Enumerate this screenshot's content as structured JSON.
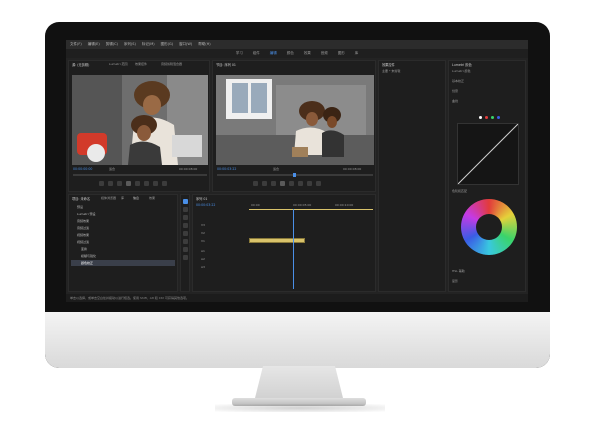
{
  "menu": [
    "文件(F)",
    "编辑(E)",
    "剪辑(C)",
    "序列(S)",
    "标记(M)",
    "图形(G)",
    "窗口(W)",
    "帮助(H)"
  ],
  "workspaces": [
    "学习",
    "组件",
    "编辑",
    "颜色",
    "效果",
    "音频",
    "图形",
    "库"
  ],
  "source_panel": {
    "title": "源: (无剪辑)",
    "tabs": [
      "Lumetri 范围",
      "效果控件",
      "音频剪辑混合器"
    ],
    "timecode": "00:00:00:00",
    "scale": "适合",
    "duration": "00:00:08:00"
  },
  "program_panel": {
    "title": "节目: 序列 01",
    "timecode": "00:00:03:22",
    "scale": "适合",
    "duration": "00:00:08:00"
  },
  "project_panel": {
    "title": "项目: 未命名",
    "tabs": [
      "媒体浏览器",
      "库",
      "信息",
      "效果"
    ],
    "items": [
      "预设",
      "Lumetri 预设",
      "音频效果",
      "音频过渡",
      "视频效果",
      "视频过渡",
      "变换",
      "模糊与锐化",
      "颜色校正"
    ]
  },
  "timeline_panel": {
    "title": "序列 01",
    "timecode": "00:00:03:22",
    "tracks": [
      "V3",
      "V2",
      "V1",
      "A1",
      "A2",
      "A3"
    ],
    "ruler": [
      "00:00",
      "00:00:05:00",
      "00:00:10:00"
    ]
  },
  "lumetri_panel": {
    "title": "Lumetri 颜色",
    "sections": [
      "基本校正",
      "创意",
      "曲线",
      "色轮和匹配",
      "HSL 辅助",
      "晕影"
    ],
    "effect_label": "Lumetri 颜色"
  },
  "effects_panel": {
    "title": "效果控件",
    "row": "主要 * 未剪辑"
  },
  "status": "单击以选择，或单击空白处并拖动以进行框选。使用 Shift、Alt 和 Ctrl 可获得其他选项。"
}
